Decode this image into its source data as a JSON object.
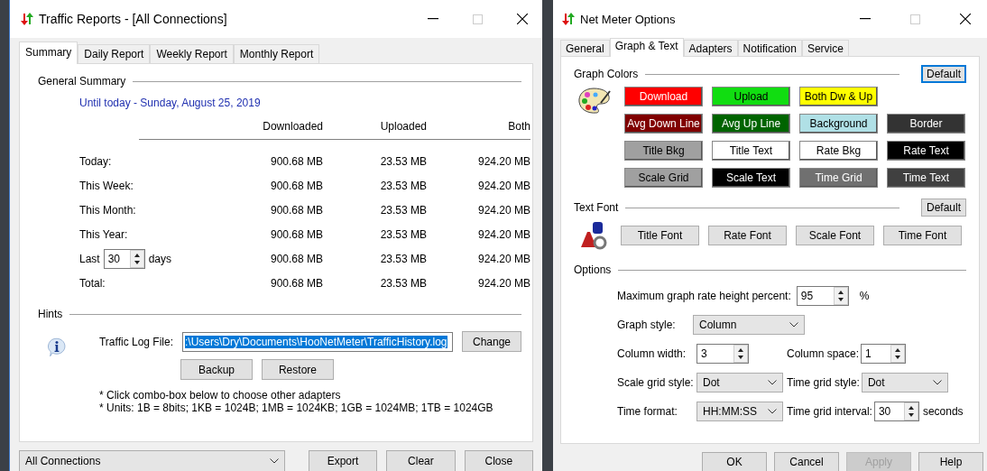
{
  "traffic_window": {
    "title": "Traffic Reports - [All Connections]",
    "tabs": [
      {
        "label": "Summary",
        "selected": true
      },
      {
        "label": "Daily Report",
        "selected": false
      },
      {
        "label": "Weekly Report",
        "selected": false
      },
      {
        "label": "Monthly Report",
        "selected": false
      }
    ],
    "general_summary": {
      "heading": "General Summary",
      "date": "Until today - Sunday, August 25, 2019",
      "columns": [
        "Downloaded",
        "Uploaded",
        "Both"
      ],
      "rows": [
        {
          "kind": "plain",
          "label": "Today:",
          "downloaded": "900.68 MB",
          "uploaded": "23.53 MB",
          "both": "924.20 MB"
        },
        {
          "kind": "plain",
          "label": "This Week:",
          "downloaded": "900.68 MB",
          "uploaded": "23.53 MB",
          "both": "924.20 MB"
        },
        {
          "kind": "plain",
          "label": "This Month:",
          "downloaded": "900.68 MB",
          "uploaded": "23.53 MB",
          "both": "924.20 MB"
        },
        {
          "kind": "plain",
          "label": "This Year:",
          "downloaded": "900.68 MB",
          "uploaded": "23.53 MB",
          "both": "924.20 MB"
        },
        {
          "kind": "days",
          "label": "Last",
          "value": "30",
          "unit": "days",
          "downloaded": "900.68 MB",
          "uploaded": "23.53 MB",
          "both": "924.20 MB"
        },
        {
          "kind": "plain",
          "label": "Total:",
          "downloaded": "900.68 MB",
          "uploaded": "23.53 MB",
          "both": "924.20 MB"
        }
      ]
    },
    "hints": {
      "heading": "Hints",
      "log_label": "Traffic Log File:",
      "log_path": ":\\Users\\Dry\\Documents\\HooNetMeter\\TrafficHistory.log",
      "change_button": "Change",
      "backup_button": "Backup",
      "restore_button": "Restore",
      "notes": [
        "* Click combo-box below to choose other adapters",
        "* Units: 1B = 8bits; 1KB = 1024B; 1MB = 1024KB; 1GB = 1024MB; 1TB = 1024GB"
      ]
    },
    "footer": {
      "connection": "All Connections",
      "buttons": [
        "Export",
        "Clear",
        "Close"
      ]
    }
  },
  "options_window": {
    "title": "Net Meter Options",
    "tabs": [
      {
        "label": "General",
        "selected": false
      },
      {
        "label": "Graph & Text",
        "selected": true
      },
      {
        "label": "Adapters",
        "selected": false
      },
      {
        "label": "Notification",
        "selected": false
      },
      {
        "label": "Service",
        "selected": false
      }
    ],
    "graph_colors": {
      "heading": "Graph Colors",
      "default_button": "Default",
      "buttons": [
        {
          "label": "Download",
          "color": "#ff0000"
        },
        {
          "label": "Upload",
          "color": "#11dd11"
        },
        {
          "label": "Both Dw & Up",
          "color": "#ffff00"
        },
        {
          "label": "Avg Down Line",
          "color": "#800000"
        },
        {
          "label": "Avg Up Line",
          "color": "#006400"
        },
        {
          "label": "Background",
          "color": "#b0e0e6"
        },
        {
          "label": "Border",
          "color": "#333333"
        },
        {
          "label": "Title Bkg",
          "color": "#a0a0a0"
        },
        {
          "label": "Title Text",
          "color": "#ffffff"
        },
        {
          "label": "Rate Bkg",
          "color": "#ffffff"
        },
        {
          "label": "Rate Text",
          "color": "#000000"
        },
        {
          "label": "Scale Grid",
          "color": "#a0a0a0"
        },
        {
          "label": "Scale Text",
          "color": "#000000"
        },
        {
          "label": "Time Grid",
          "color": "#707070"
        },
        {
          "label": "Time Text",
          "color": "#404040"
        }
      ]
    },
    "text_font": {
      "heading": "Text Font",
      "default_button": "Default",
      "buttons": [
        "Title Font",
        "Rate Font",
        "Scale Font",
        "Time Font"
      ]
    },
    "options": {
      "heading": "Options",
      "rows": [
        [
          {
            "kind": "spin",
            "label": "Maximum graph rate height percent:",
            "value": "95",
            "unit": "%"
          }
        ],
        [
          {
            "kind": "combo",
            "label": "Graph style:",
            "value": "Column"
          }
        ],
        [
          {
            "kind": "spin",
            "label": "Column width:",
            "value": "3"
          },
          {
            "kind": "spin",
            "label": "Column space:",
            "value": "1"
          }
        ],
        [
          {
            "kind": "combo",
            "label": "Scale grid style:",
            "value": "Dot"
          },
          {
            "kind": "combo",
            "label": "Time grid style:",
            "value": "Dot"
          }
        ],
        [
          {
            "kind": "combo",
            "label": "Time format:",
            "value": "HH:MM:SS"
          },
          {
            "kind": "spin",
            "label": "Time grid interval:",
            "value": "30",
            "unit": "seconds"
          }
        ]
      ]
    },
    "footer": [
      {
        "label": "OK",
        "disabled": false
      },
      {
        "label": "Cancel",
        "disabled": false
      },
      {
        "label": "Apply",
        "disabled": true
      },
      {
        "label": "Help",
        "disabled": false
      }
    ]
  }
}
